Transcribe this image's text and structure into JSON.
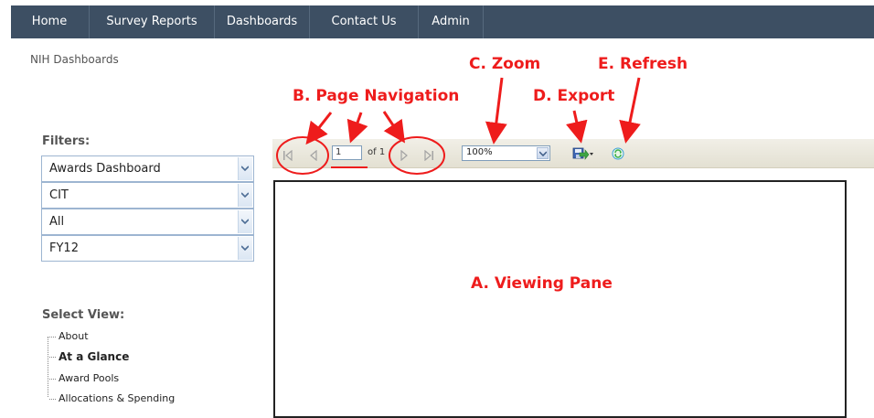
{
  "nav": {
    "items": [
      "Home",
      "Survey Reports",
      "Dashboards",
      "Contact Us",
      "Admin"
    ]
  },
  "site_title": "NIH Dashboards",
  "filters": {
    "label": "Filters:",
    "selects": [
      "Awards Dashboard",
      "CIT",
      "All",
      "FY12"
    ]
  },
  "select_view": {
    "label": "Select View:",
    "items": [
      "About",
      "At a Glance",
      "Award Pools",
      "Allocations & Spending"
    ],
    "selected": "At a Glance"
  },
  "toolbar": {
    "page_value": "1",
    "of_text": "of 1",
    "zoom": "100%"
  },
  "annotations": {
    "viewing_pane": "A. Viewing Pane",
    "page_navigation": "B. Page Navigation",
    "zoom": "C. Zoom",
    "export": "D. Export",
    "refresh": "E. Refresh"
  },
  "colors": {
    "nav_bg": "#3d4f63",
    "annotation": "#ee1c1c",
    "toolbar_bg": "#e9e6da"
  },
  "icons": [
    "first-page-icon",
    "previous-page-icon",
    "next-page-icon",
    "last-page-icon",
    "export-save-icon",
    "refresh-icon",
    "chevron-down-icon"
  ]
}
